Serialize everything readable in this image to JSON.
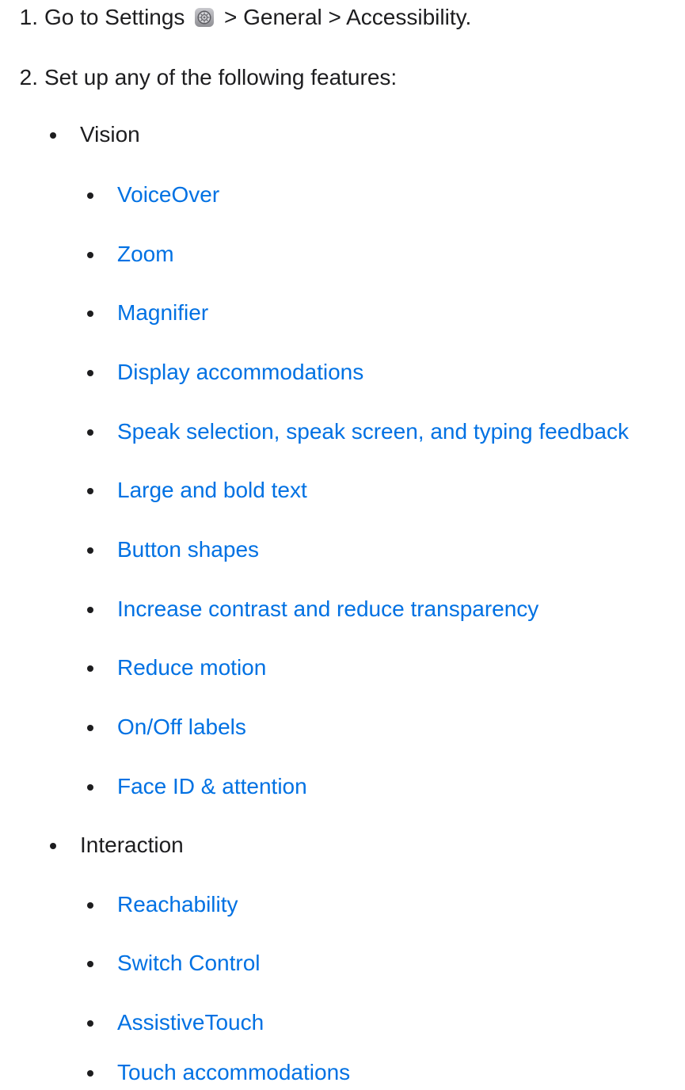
{
  "steps": [
    {
      "number": "1.",
      "text_before_icon": "Go to Settings",
      "icon": "settings-gear-icon",
      "text_after_icon": "> General > Accessibility."
    },
    {
      "number": "2.",
      "text": "Set up any of the following features:"
    }
  ],
  "sections": [
    {
      "label": "Vision",
      "items": [
        "VoiceOver",
        "Zoom",
        "Magnifier",
        "Display accommodations",
        "Speak selection, speak screen, and typing feedback",
        "Large and bold text",
        "Button shapes",
        "Increase contrast and reduce transparency",
        "Reduce motion",
        "On/Off labels",
        "Face ID & attention"
      ]
    },
    {
      "label": "Interaction",
      "items": [
        "Reachability",
        "Switch Control",
        "AssistiveTouch",
        "Touch accommodations"
      ]
    }
  ],
  "colors": {
    "text": "#1d1d1f",
    "link": "#0071e3"
  }
}
